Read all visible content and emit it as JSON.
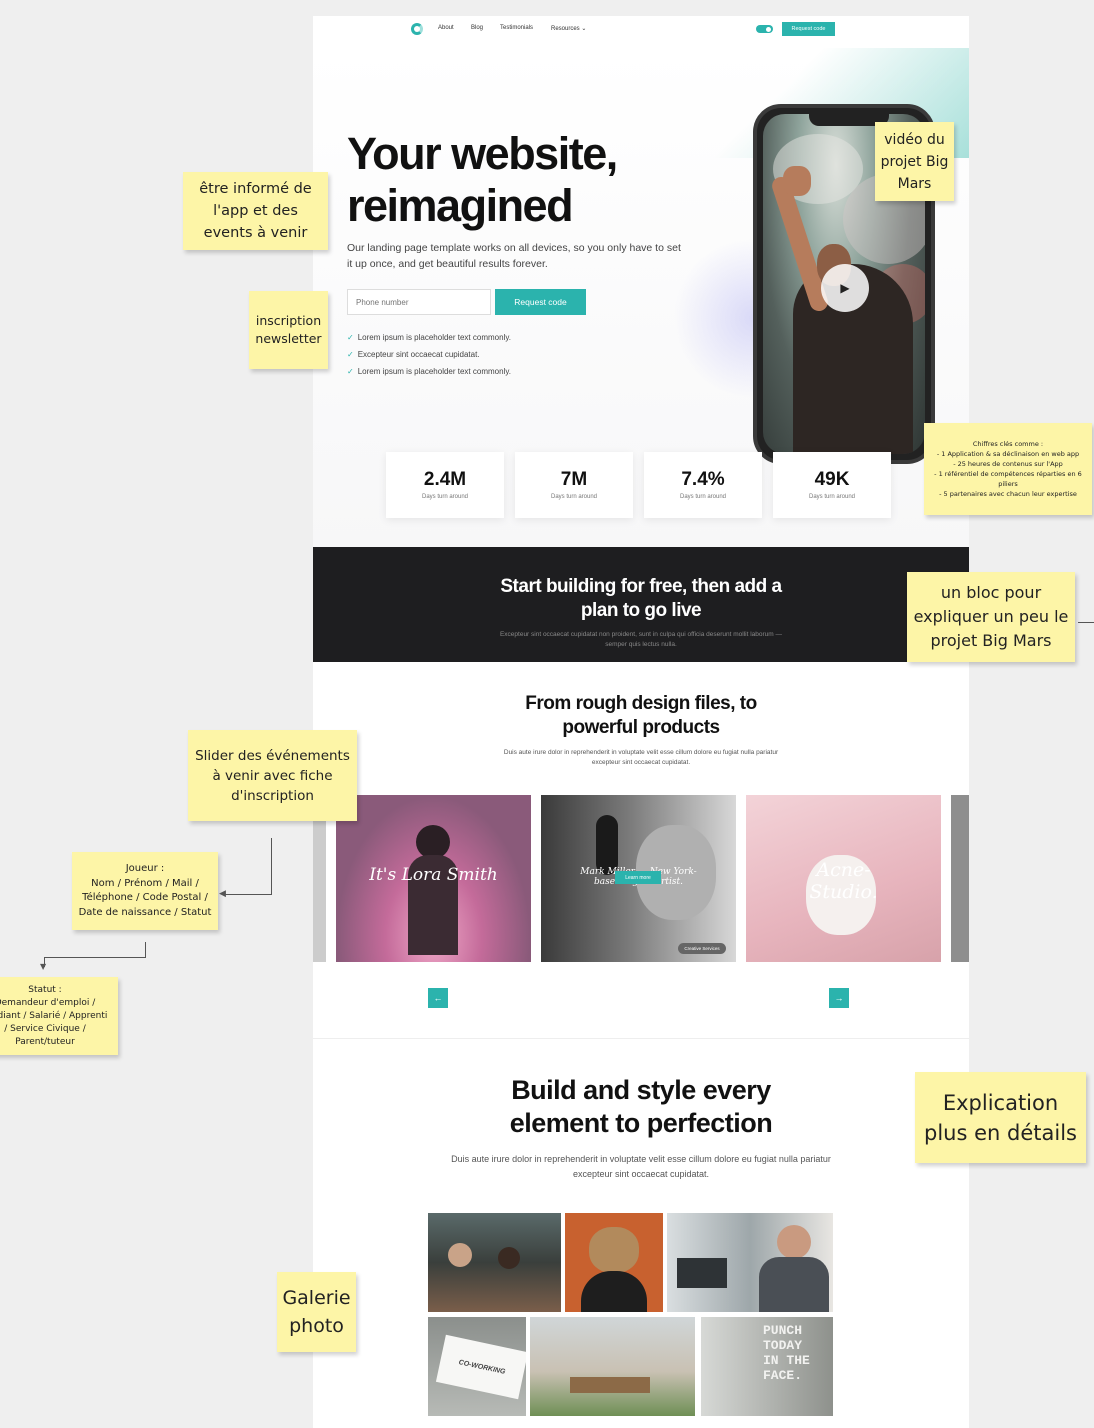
{
  "nav": {
    "links": [
      "About",
      "Blog",
      "Testimonials",
      "Resources ⌄"
    ],
    "cta": "Request code"
  },
  "hero": {
    "title": "Your website, reimagined",
    "description": "Our landing page template works on all devices, so you only have to set it up once, and get beautiful results forever.",
    "input_placeholder": "Phone number",
    "button": "Request code",
    "checks": [
      "Lorem ipsum is placeholder text commonly.",
      "Excepteur sint occaecat cupidatat.",
      "Lorem ipsum is placeholder text commonly."
    ]
  },
  "stats": [
    {
      "value": "2.4M",
      "label": "Days turn around"
    },
    {
      "value": "7M",
      "label": "Days turn around"
    },
    {
      "value": "7.4%",
      "label": "Days turn around"
    },
    {
      "value": "49K",
      "label": "Days turn around"
    }
  ],
  "dark_section": {
    "title": "Start building for free, then add a plan to go live",
    "description": "Excepteur sint occaecat cupidatat non proident, sunt in culpa qui officia deserunt mollit laborum — semper quis lectus nulla."
  },
  "products": {
    "title": "From rough design files, to powerful products",
    "description": "Duis aute irure dolor in reprehenderit in voluptate velit esse cillum dolore eu fugiat nulla pariatur excepteur sint occaecat cupidatat.",
    "slides": [
      {
        "text": "It's Lora Smith"
      },
      {
        "text": "Mark Miller — New York-based digital artist.",
        "button": "Learn more",
        "tag": "Creative Services"
      },
      {
        "text": "Acne-Studio."
      }
    ],
    "prev_icon": "←",
    "next_icon": "→"
  },
  "build": {
    "title": "Build and style every element to perfection",
    "description": "Duis aute irure dolor in reprehenderit in voluptate velit esse cillum dolore eu fugiat nulla pariatur excepteur sint occaecat cupidatat."
  },
  "gallery": {
    "coworking_label": "CO-WORKING",
    "punch_label": "PUNCH TODAY IN THE FACE."
  },
  "notes": {
    "video": "vidéo du projet Big Mars",
    "informed": "être informé de l'app et des events à venir",
    "newsletter": "inscription newsletter",
    "key_figures": "Chiffres clés comme :\n- 1 Application & sa déclinaison en web app\n- 25 heures de contenus sur l'App\n- 1 référentiel de compétences réparties en 6 piliers\n- 5 partenaires avec chacun leur expertise",
    "bloc": "un bloc pour expliquer un peu le projet Big Mars",
    "slider": "Slider des événements à venir avec fiche d'inscription",
    "joueur": "Joueur :\nNom / Prénom / Mail /\nTéléphone / Code Postal /\nDate de naissance / Statut",
    "statut": "Statut :\nDemandeur d'emploi /\nÉtudiant / Salarié / Apprenti\n/ Service Civique /\nParent/tuteur",
    "explication": "Explication plus en détails",
    "galerie": "Galerie photo"
  },
  "colors": {
    "accent": "#2bb3ad",
    "dark_band": "#1e1e20",
    "sticky_note": "#fdf5a7"
  }
}
